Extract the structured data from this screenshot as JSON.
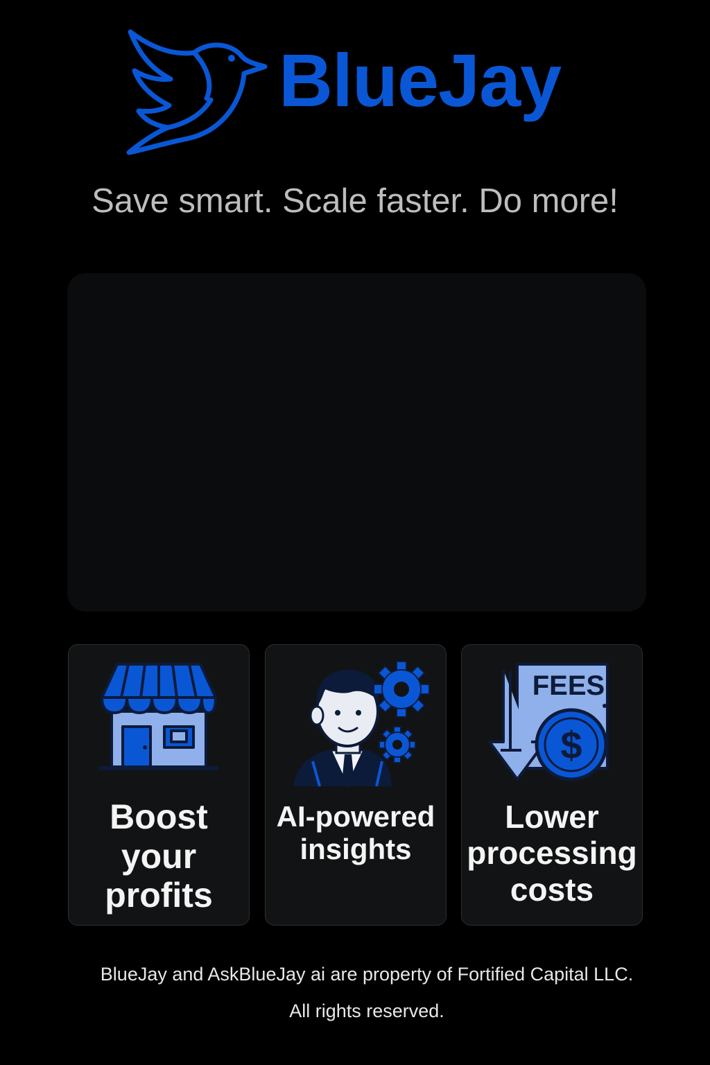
{
  "brand": {
    "name": "BlueJay",
    "logo_icon": "bluejay-bird-icon",
    "color": "#0a57d6"
  },
  "tagline": "Save smart. Scale faster. Do more!",
  "features": [
    {
      "icon": "storefront-icon",
      "label": "Boost\nyour\nprofits"
    },
    {
      "icon": "ai-businessman-gears-icon",
      "label": "AI-powered\ninsights"
    },
    {
      "icon": "fees-down-dollar-icon",
      "label": "Lower\nprocessing\ncosts",
      "icon_text": "FEES"
    }
  ],
  "footer": {
    "line1": "BlueJay and AskBlueJay ai are property of Fortified Capital LLC.",
    "line2": "All rights reserved."
  },
  "colors": {
    "background": "#000000",
    "accent": "#0a57d6",
    "icon_light": "#8fb0ea",
    "tagline": "#bdbdbd"
  }
}
